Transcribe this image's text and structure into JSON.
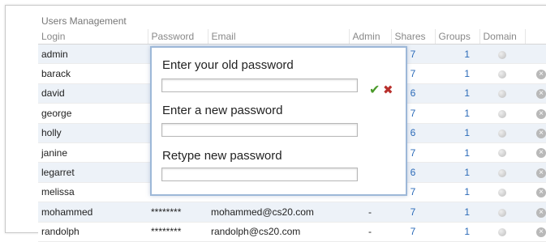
{
  "panel": {
    "title": "Users Management"
  },
  "columns": [
    "Login",
    "Password",
    "Email",
    "Admin",
    "Shares",
    "Groups",
    "Domain"
  ],
  "icons": {
    "domain": "gray-dot-icon",
    "delete": "delete-circle-icon"
  },
  "rows": [
    {
      "login": "admin",
      "password": "",
      "email": "",
      "admin": "",
      "shares": "7",
      "groups": "1",
      "has_delete": false
    },
    {
      "login": "barack",
      "password": "",
      "email": "",
      "admin": "",
      "shares": "7",
      "groups": "1",
      "has_delete": true
    },
    {
      "login": "david",
      "password": "",
      "email": "",
      "admin": "",
      "shares": "6",
      "groups": "1",
      "has_delete": true
    },
    {
      "login": "george",
      "password": "",
      "email": "",
      "admin": "",
      "shares": "7",
      "groups": "1",
      "has_delete": true
    },
    {
      "login": "holly",
      "password": "",
      "email": "",
      "admin": "",
      "shares": "6",
      "groups": "1",
      "has_delete": true
    },
    {
      "login": "janine",
      "password": "",
      "email": "",
      "admin": "",
      "shares": "7",
      "groups": "1",
      "has_delete": true
    },
    {
      "login": "legarret",
      "password": "",
      "email": "",
      "admin": "",
      "shares": "6",
      "groups": "1",
      "has_delete": true
    },
    {
      "login": "melissa",
      "password": "",
      "email": "",
      "admin": "",
      "shares": "7",
      "groups": "1",
      "has_delete": true
    },
    {
      "login": "mohammed",
      "password": "********",
      "email": "mohammed@cs20.com",
      "admin": "-",
      "shares": "7",
      "groups": "1",
      "has_delete": true
    },
    {
      "login": "randolph",
      "password": "********",
      "email": "randolph@cs20.com",
      "admin": "-",
      "shares": "7",
      "groups": "1",
      "has_delete": true
    }
  ],
  "dialog": {
    "old_password_label": "Enter your old password",
    "new_password_label": "Enter a new password",
    "retype_password_label": "Retype new password",
    "old_password_value": "",
    "new_password_value": "",
    "retype_password_value": ""
  }
}
